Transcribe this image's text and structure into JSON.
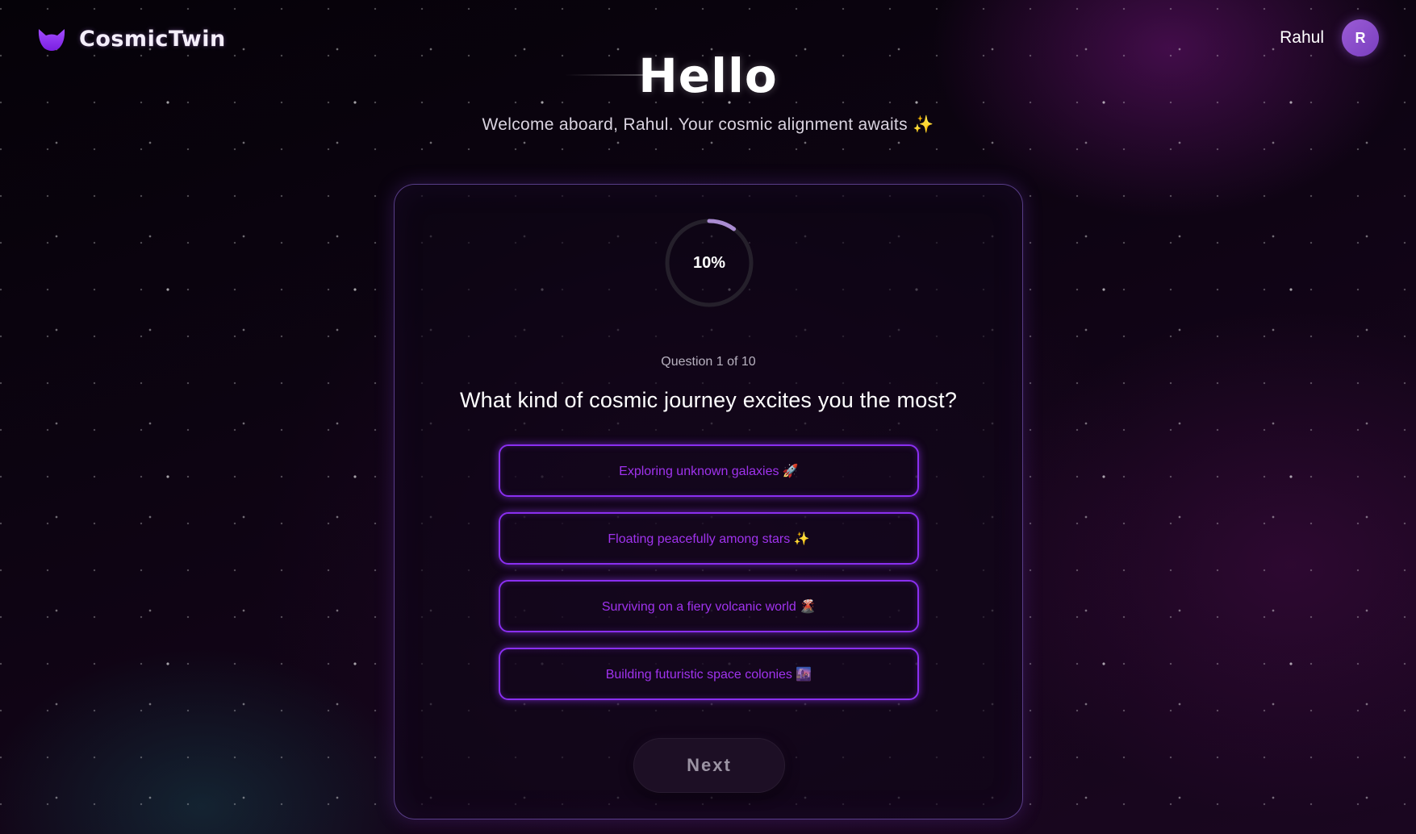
{
  "header": {
    "brand_name": "CosmicTwin",
    "logo_icon": "cat-ears-logo-icon",
    "user_name": "Rahul",
    "avatar_initial": "R"
  },
  "hero": {
    "title": "Hello",
    "subtitle": "Welcome aboard, Rahul. Your cosmic alignment awaits ✨"
  },
  "quiz": {
    "progress_percent": 10,
    "progress_label": "10%",
    "question_count": "Question 1 of 10",
    "question": "What kind of cosmic journey excites you the most?",
    "options": [
      {
        "label": "Exploring unknown galaxies 🚀"
      },
      {
        "label": "Floating peacefully among stars ✨"
      },
      {
        "label": "Surviving on a fiery volcanic world 🌋"
      },
      {
        "label": "Building futuristic space colonies 🌆"
      }
    ],
    "next_label": "Next"
  },
  "colors": {
    "accent": "#8a2ff0",
    "option_text": "#a033ee",
    "progress_arc": "#a98bd1",
    "avatar": "#8c4fd0"
  }
}
